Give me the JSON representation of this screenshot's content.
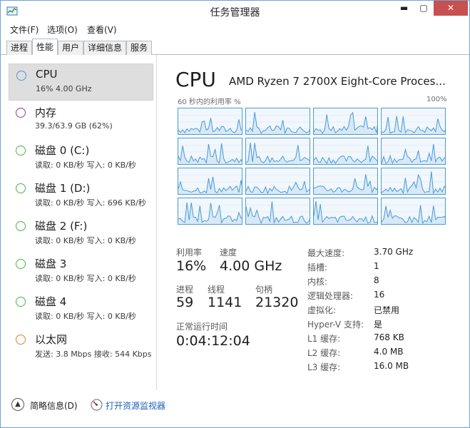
{
  "window": {
    "title": "任务管理器",
    "minimize_glyph": "▬",
    "maximize_glyph": "▢",
    "close_glyph": "✕"
  },
  "menu": [
    "文件(F)",
    "选项(O)",
    "查看(V)"
  ],
  "tabs": [
    {
      "label": "进程",
      "active": false
    },
    {
      "label": "性能",
      "active": true
    },
    {
      "label": "用户",
      "active": false
    },
    {
      "label": "详细信息",
      "active": false
    },
    {
      "label": "服务",
      "active": false
    }
  ],
  "resources": [
    {
      "name": "CPU",
      "detail": "16% 4.00 GHz",
      "color": "#4a9ad8",
      "selected": true
    },
    {
      "name": "内存",
      "detail": "39.3/63.9 GB (62%)",
      "color": "#9b36a8",
      "selected": false
    },
    {
      "name": "磁盘 0 (C:)",
      "detail": "读取: 0 KB/秒 写入: 0 KB/秒",
      "color": "#4ab44a",
      "selected": false
    },
    {
      "name": "磁盘 1 (D:)",
      "detail": "读取: 0 KB/秒 写入: 696 KB/秒",
      "color": "#4ab44a",
      "selected": false
    },
    {
      "name": "磁盘 2 (F:)",
      "detail": "读取: 0 KB/秒 写入: 0 KB/秒",
      "color": "#4ab44a",
      "selected": false
    },
    {
      "name": "磁盘 3",
      "detail": "读取: 0 KB/秒 写入: 0 KB/秒",
      "color": "#4ab44a",
      "selected": false
    },
    {
      "name": "磁盘 4",
      "detail": "读取: 0 KB/秒 写入: 0 KB/秒",
      "color": "#4ab44a",
      "selected": false
    },
    {
      "name": "以太网",
      "detail": "发送: 3.8 Mbps 接收: 544 Kbps",
      "color": "#d9832b",
      "selected": false
    }
  ],
  "cpu": {
    "title": "CPU",
    "model": "AMD Ryzen 7 2700X Eight-Core Proces...",
    "graph_caption": "60 秒内的利用率 %",
    "graph_max": "100%",
    "core_graph_count": 16,
    "accent_color": "#4a9ad8",
    "stats": {
      "utilization_label": "利用率",
      "utilization_value": "16%",
      "speed_label": "速度",
      "speed_value": "4.00 GHz",
      "processes_label": "进程",
      "processes_value": "59",
      "threads_label": "线程",
      "threads_value": "1141",
      "handles_label": "句柄",
      "handles_value": "21320",
      "uptime_label": "正常运行时间",
      "uptime_value": "0:04:12:04"
    },
    "specs": [
      {
        "label": "最大速度:",
        "value": "3.70 GHz"
      },
      {
        "label": "插槽:",
        "value": "1"
      },
      {
        "label": "内核:",
        "value": "8"
      },
      {
        "label": "逻辑处理器:",
        "value": "16"
      },
      {
        "label": "虚拟化:",
        "value": "已禁用"
      },
      {
        "label": "Hyper-V 支持:",
        "value": "是"
      },
      {
        "label": "L1 缓存:",
        "value": "768 KB"
      },
      {
        "label": "L2 缓存:",
        "value": "4.0 MB"
      },
      {
        "label": "L3 缓存:",
        "value": "16.0 MB"
      }
    ]
  },
  "footer": {
    "fewer_details": "简略信息(D)",
    "resource_monitor": "打开资源监视器"
  }
}
